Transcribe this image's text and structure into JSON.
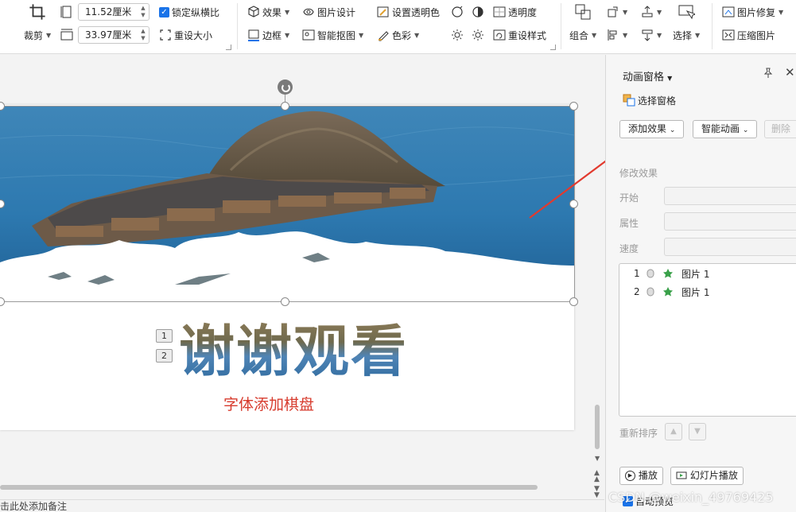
{
  "ribbon": {
    "crop_label": "裁剪",
    "height_value": "11.52厘米",
    "width_value": "33.97厘米",
    "lock_ratio_label": "锁定纵横比",
    "resize_label": "重设大小",
    "effects_label": "效果",
    "picture_design_label": "图片设计",
    "set_transparent_label": "设置透明色",
    "transparency_label": "透明度",
    "border_label": "边框",
    "smart_cutout_label": "智能抠图",
    "color_label": "色彩",
    "reset_style_label": "重设样式",
    "group_label": "组合",
    "select_label": "选择",
    "picture_repair_label": "图片修复",
    "compress_label": "压缩图片"
  },
  "slide": {
    "title": "谢谢观看",
    "subtitle": "字体添加棋盘",
    "anim_tags": [
      "1",
      "2"
    ]
  },
  "notes_placeholder": "击此处添加备注",
  "pane": {
    "title": "动画窗格",
    "selection_pane_label": "选择窗格",
    "add_effect_label": "添加效果",
    "smart_anim_label": "智能动画",
    "delete_label": "删除",
    "modify_effect_label": "修改效果",
    "start_label": "开始",
    "property_label": "属性",
    "speed_label": "速度",
    "items": [
      {
        "index": "1",
        "name": "图片 1"
      },
      {
        "index": "2",
        "name": "图片 1"
      }
    ],
    "reorder_label": "重新排序",
    "play_label": "播放",
    "slideshow_label": "幻灯片播放",
    "autopreview_label": "自动预览"
  },
  "watermark": "CSDN @weixin_49769425",
  "colors": {
    "accent_blue": "#1a73e8",
    "subtitle_red": "#d73b2d",
    "arrow_red": "#e23a2e"
  }
}
